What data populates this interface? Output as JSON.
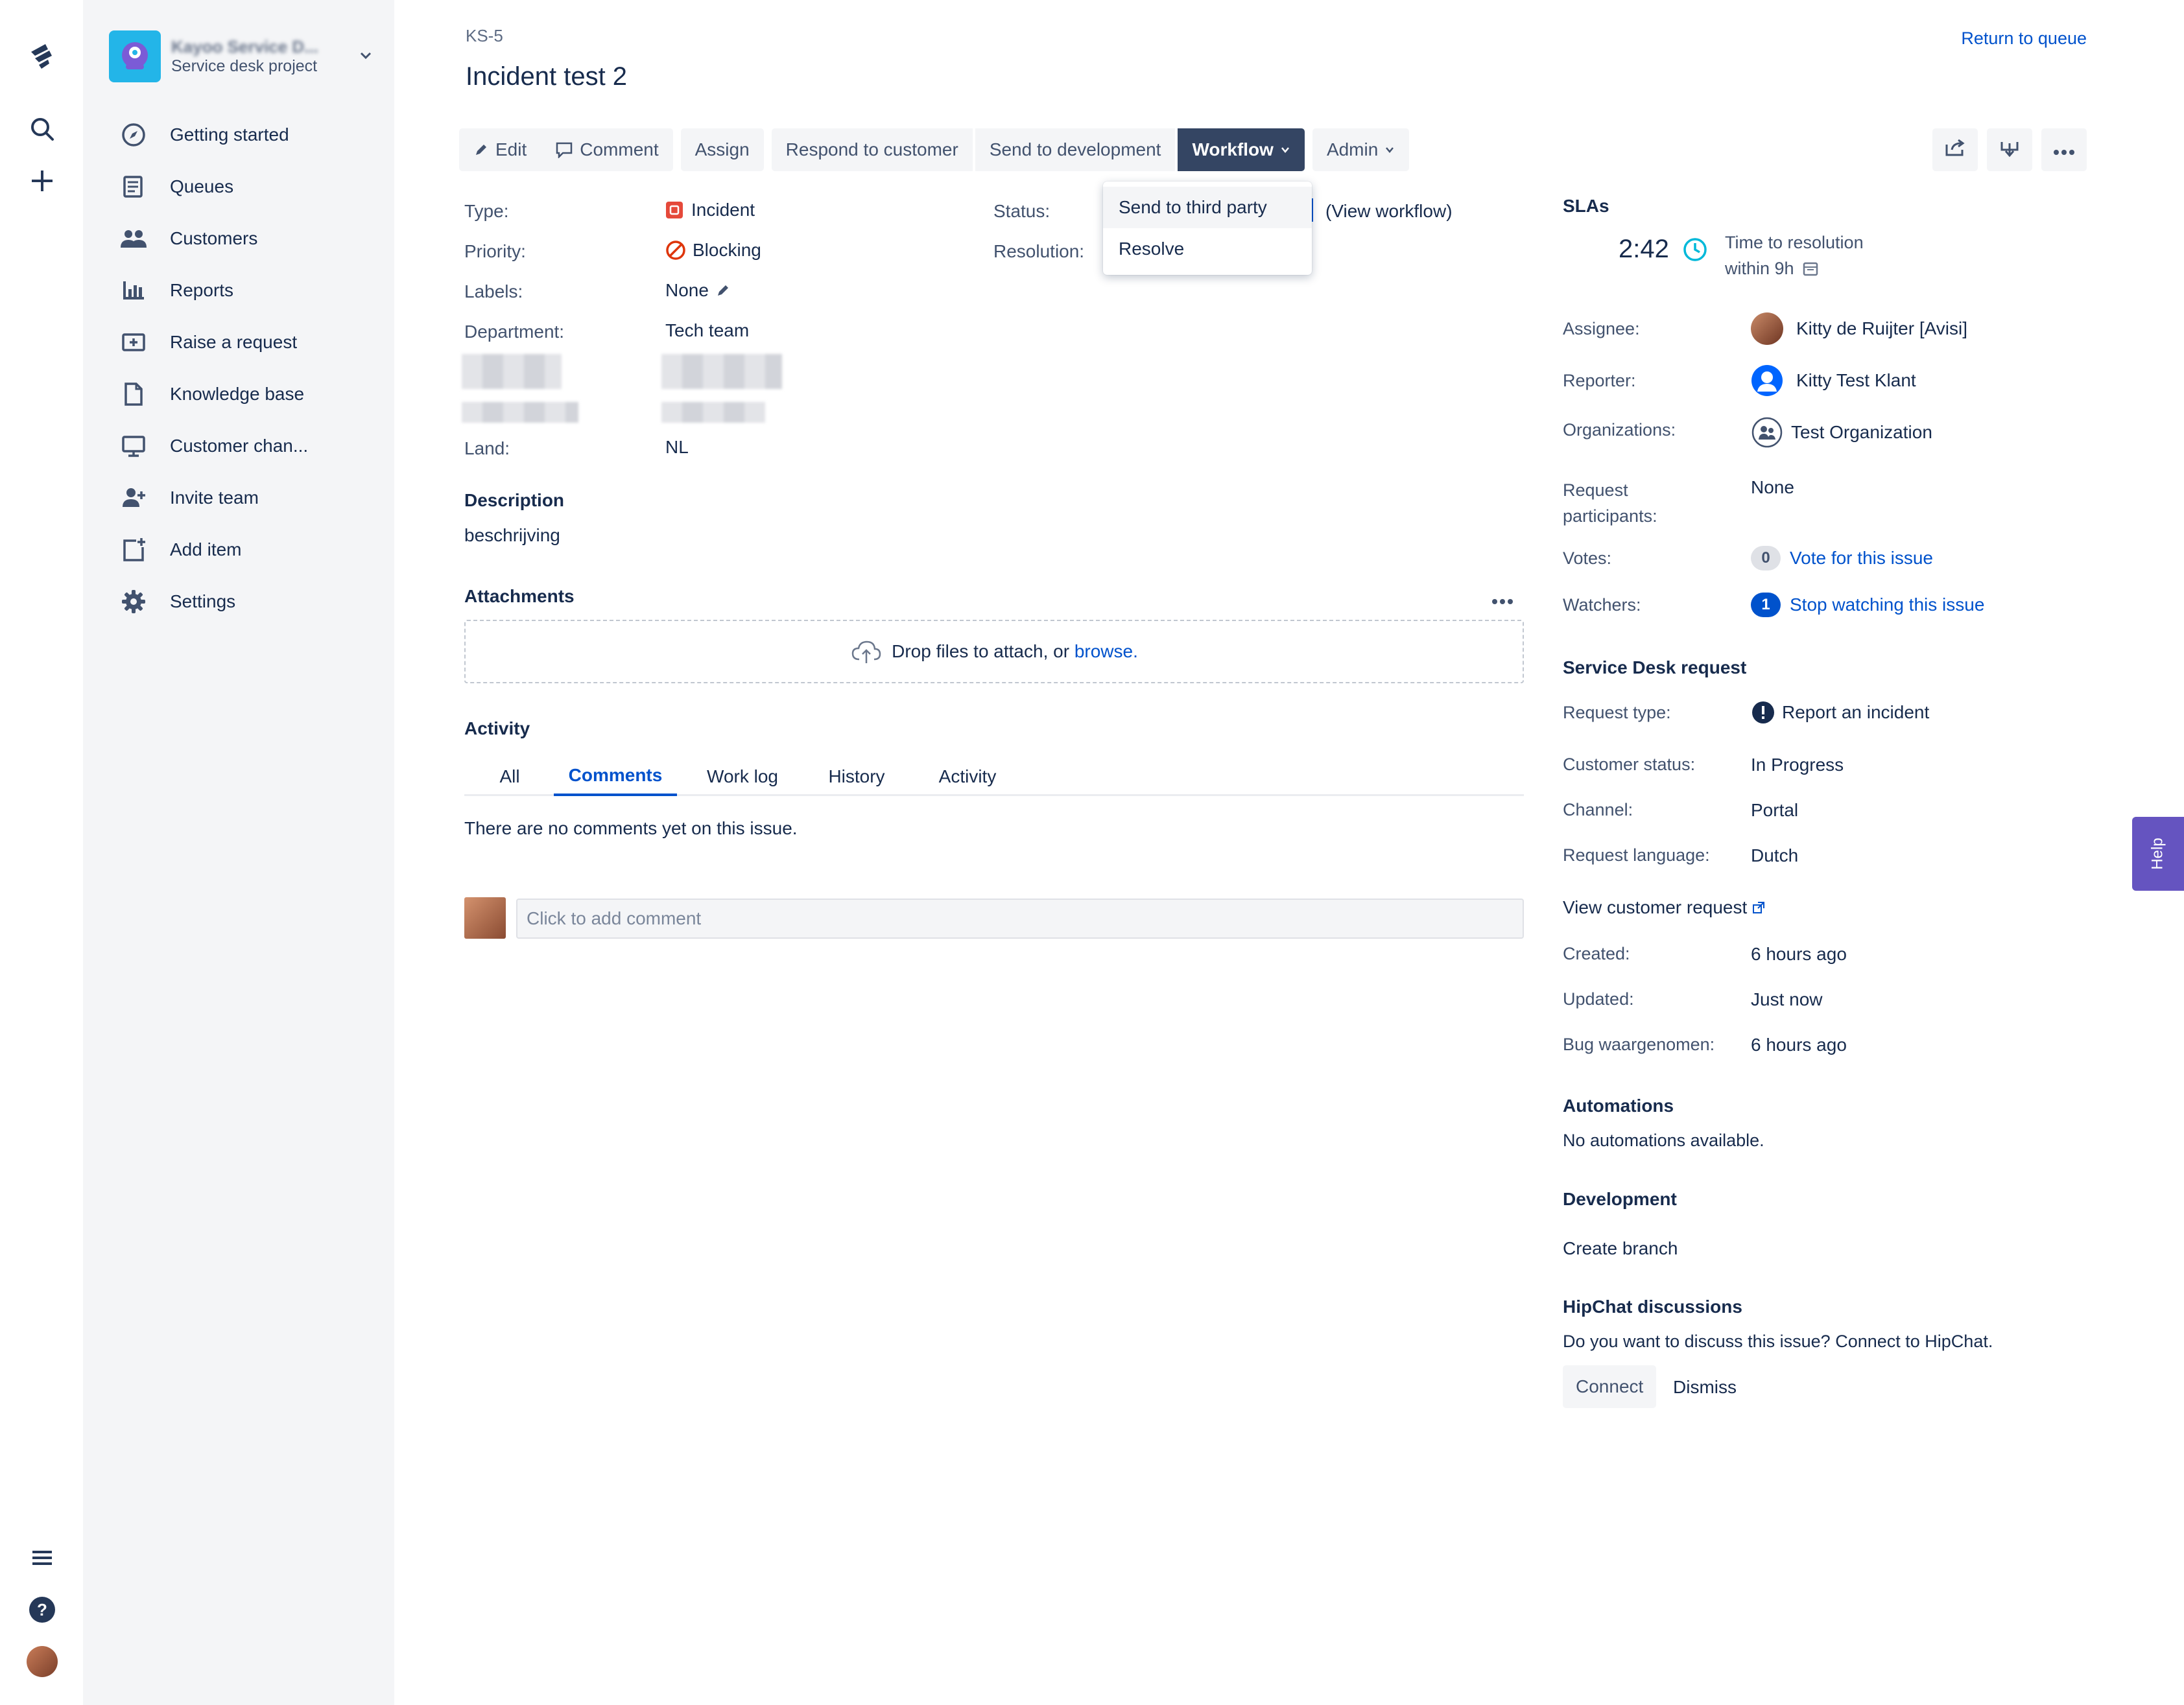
{
  "project": {
    "name": "Kayoo Service D...",
    "type": "Service desk project"
  },
  "sidebar": {
    "items": [
      {
        "label": "Getting started",
        "icon": "compass-icon"
      },
      {
        "label": "Queues",
        "icon": "queues-icon"
      },
      {
        "label": "Customers",
        "icon": "customers-icon"
      },
      {
        "label": "Reports",
        "icon": "reports-icon"
      },
      {
        "label": "Raise a request",
        "icon": "raise-request-icon"
      },
      {
        "label": "Knowledge base",
        "icon": "document-icon"
      },
      {
        "label": "Customer chan...",
        "icon": "monitor-icon"
      },
      {
        "label": "Invite team",
        "icon": "invite-user-icon"
      },
      {
        "label": "Add item",
        "icon": "add-item-icon"
      },
      {
        "label": "Settings",
        "icon": "gear-icon"
      }
    ]
  },
  "issue": {
    "key": "KS-5",
    "title": "Incident test 2",
    "return_label": "Return to queue"
  },
  "toolbar": {
    "edit": "Edit",
    "comment": "Comment",
    "assign": "Assign",
    "respond": "Respond to customer",
    "send_dev": "Send to development",
    "workflow": "Workflow",
    "admin": "Admin"
  },
  "workflow_menu": {
    "items": [
      "Send to third party",
      "Resolve"
    ]
  },
  "details": {
    "type_label": "Type:",
    "type_value": "Incident",
    "priority_label": "Priority:",
    "priority_value": "Blocking",
    "labels_label": "Labels:",
    "labels_value": "None",
    "department_label": "Department:",
    "department_value": "Tech team",
    "land_label": "Land:",
    "land_value": "NL",
    "status_label": "Status:",
    "resolution_label": "Resolution:",
    "view_workflow": "(View workflow)"
  },
  "description": {
    "heading": "Description",
    "text": "beschrijving"
  },
  "attachments": {
    "heading": "Attachments",
    "drop_text": "Drop files to attach, or ",
    "browse": "browse."
  },
  "activity": {
    "heading": "Activity",
    "tabs": [
      "All",
      "Comments",
      "Work log",
      "History",
      "Activity"
    ],
    "active_tab": "Comments",
    "empty": "There are no comments yet on this issue.",
    "comment_placeholder": "Click to add comment"
  },
  "slas": {
    "heading": "SLAs",
    "time": "2:42",
    "name": "Time to resolution",
    "goal": "within 9h"
  },
  "people": {
    "assignee_label": "Assignee:",
    "assignee": "Kitty de Ruijter [Avisi]",
    "reporter_label": "Reporter:",
    "reporter": "Kitty Test Klant",
    "organizations_label": "Organizations:",
    "organization": "Test Organization",
    "participants_label_1": "Request",
    "participants_label_2": "participants:",
    "participants": "None",
    "votes_label": "Votes:",
    "votes_count": "0",
    "vote_link": "Vote for this issue",
    "watchers_label": "Watchers:",
    "watchers_count": "1",
    "watch_link": "Stop watching this issue"
  },
  "service_desk": {
    "heading": "Service Desk request",
    "request_type_label": "Request type:",
    "request_type": "Report an incident",
    "customer_status_label": "Customer status:",
    "customer_status": "In Progress",
    "channel_label": "Channel:",
    "channel": "Portal",
    "language_label": "Request language:",
    "language": "Dutch",
    "view_request": "View customer request"
  },
  "dates": {
    "created_label": "Created:",
    "created": "6 hours ago",
    "updated_label": "Updated:",
    "updated": "Just now",
    "bug_label": "Bug waargenomen:",
    "bug": "6 hours ago"
  },
  "automations": {
    "heading": "Automations",
    "text": "No automations available."
  },
  "development": {
    "heading": "Development",
    "create_branch": "Create branch"
  },
  "hipchat": {
    "heading": "HipChat discussions",
    "text": "Do you want to discuss this issue? Connect to HipChat.",
    "connect": "Connect",
    "dismiss": "Dismiss"
  },
  "help_tab": "Help",
  "colors": {
    "accent": "#0052cc",
    "workflow_button": "#344563",
    "incident_red": "#e5493a",
    "help_purple": "#6554c0"
  }
}
